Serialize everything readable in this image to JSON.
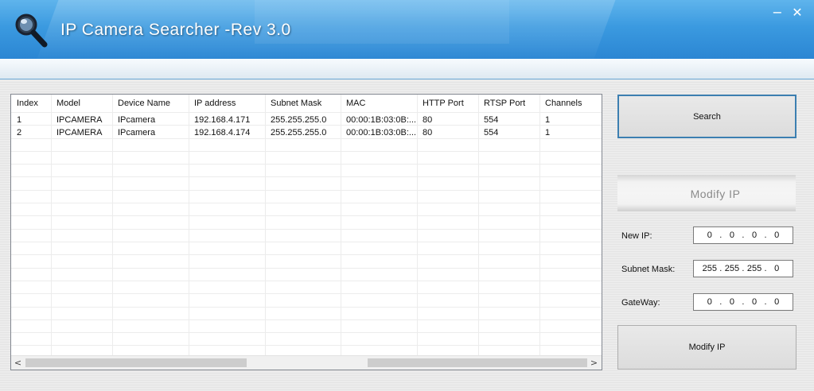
{
  "window": {
    "title": "IP Camera Searcher -Rev 3.0",
    "minimize": "−",
    "close": "✕"
  },
  "table": {
    "columns": [
      "Index",
      "Model",
      "Device Name",
      "IP address",
      "Subnet Mask",
      "MAC",
      "HTTP Port",
      "RTSP Port",
      "Channels"
    ],
    "rows": [
      [
        "1",
        "IPCAMERA",
        "IPcamera",
        "192.168.4.171",
        "255.255.255.0",
        "00:00:1B:03:0B:...",
        "80",
        "554",
        "1"
      ],
      [
        "2",
        "IPCAMERA",
        "IPcamera",
        "192.168.4.174",
        "255.255.255.0",
        "00:00:1B:03:0B:...",
        "80",
        "554",
        "1"
      ]
    ],
    "scroll_left": "<",
    "scroll_right": ">"
  },
  "panel": {
    "search_label": "Search",
    "modify_section_title": "Modify IP",
    "new_ip_label": "New IP:",
    "new_ip": [
      "0",
      "0",
      "0",
      "0"
    ],
    "subnet_label": "Subnet Mask:",
    "subnet": [
      "255",
      "255",
      "255",
      "0"
    ],
    "gateway_label": "GateWay:",
    "gateway": [
      "0",
      "0",
      "0",
      "0"
    ],
    "modify_button_label": "Modify IP"
  },
  "colors": {
    "titlebar": "#3b9ae0",
    "accent_border": "#3c7fb1"
  }
}
